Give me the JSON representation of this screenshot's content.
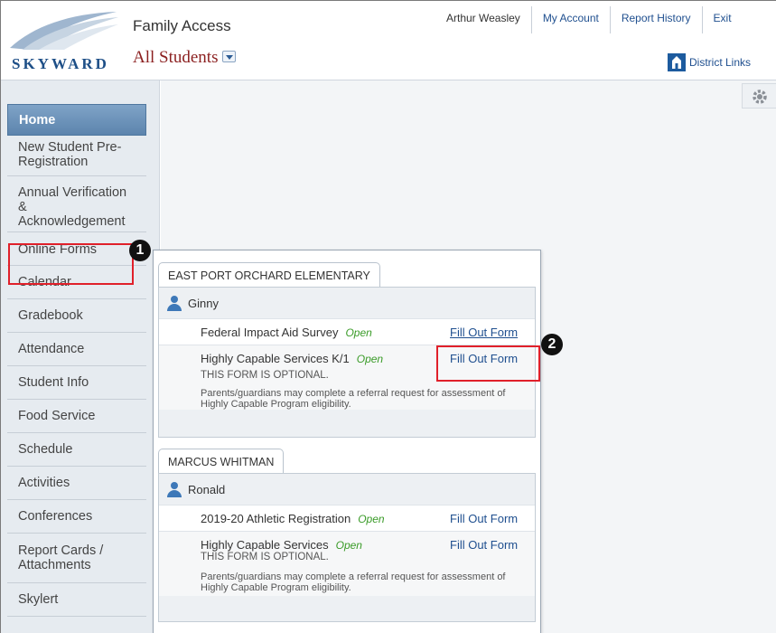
{
  "header": {
    "logo_text": "SKYWARD",
    "app_title": "Family Access",
    "student_selector": "All Students",
    "user_name": "Arthur Weasley",
    "nav": [
      "My Account",
      "Report History",
      "Exit"
    ],
    "district_links": "District Links",
    "gear_icon": "gear-icon"
  },
  "sidebar": {
    "items": [
      {
        "label": "Home"
      },
      {
        "label": "New Student Pre-Registration"
      },
      {
        "label": "Annual Verification & Acknowledgement"
      },
      {
        "label": "Online Forms"
      },
      {
        "label": "Calendar"
      },
      {
        "label": "Gradebook"
      },
      {
        "label": "Attendance"
      },
      {
        "label": "Student Info"
      },
      {
        "label": "Food Service"
      },
      {
        "label": "Schedule"
      },
      {
        "label": "Activities"
      },
      {
        "label": "Conferences"
      },
      {
        "label": "Report Cards / Attachments"
      },
      {
        "label": "Skylert"
      }
    ]
  },
  "forms": {
    "schools": [
      {
        "name": "EAST PORT ORCHARD ELEMENTARY",
        "student": "Ginny",
        "forms": [
          {
            "name": "Federal Impact Aid Survey",
            "status": "Open",
            "action": "Fill Out Form"
          },
          {
            "name": "Highly Capable Services K/1",
            "status": "Open",
            "action": "Fill Out Form",
            "note": "THIS FORM IS OPTIONAL.",
            "description": "Parents/guardians may complete a referral request for assessment of Highly Capable Program eligibility."
          }
        ]
      },
      {
        "name": "MARCUS WHITMAN",
        "student": "Ronald",
        "forms": [
          {
            "name": "2019-20 Athletic Registration",
            "status": "Open",
            "action": "Fill Out Form"
          },
          {
            "name": "Highly Capable Services",
            "status": "Open",
            "action": "Fill Out Form",
            "note": "THIS FORM IS OPTIONAL.",
            "description": "Parents/guardians may complete a referral request for assessment of Highly Capable Program eligibility."
          }
        ]
      }
    ]
  },
  "annotations": {
    "step1": "1",
    "step2": "2",
    "highlight_color": "#e0202a"
  }
}
